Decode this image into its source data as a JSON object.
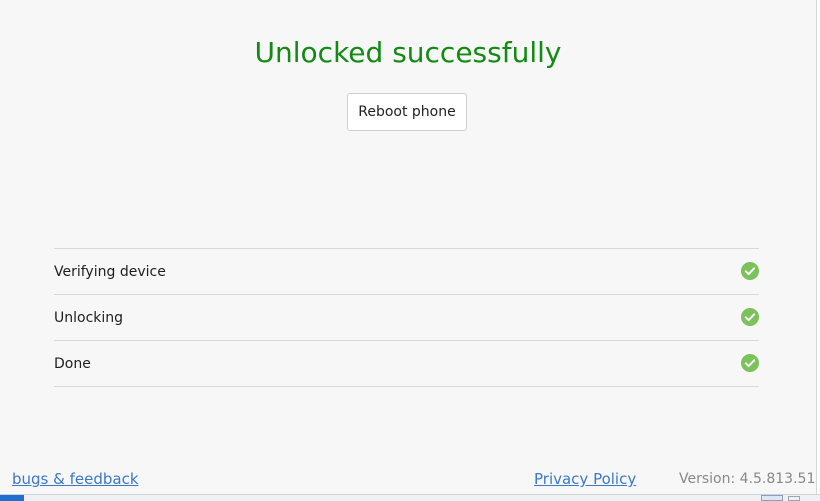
{
  "header": {
    "title": "Unlocked successfully",
    "title_color": "#138a13"
  },
  "actions": {
    "reboot_label": "Reboot phone"
  },
  "steps": [
    {
      "label": "Verifying device",
      "status": "done",
      "icon": "check-circle-icon"
    },
    {
      "label": "Unlocking",
      "status": "done",
      "icon": "check-circle-icon"
    },
    {
      "label": "Done",
      "status": "done",
      "icon": "check-circle-icon"
    }
  ],
  "footer": {
    "bugs_link": "bugs & feedback",
    "privacy_link": "Privacy Policy",
    "version": "Version: 4.5.813.51"
  },
  "colors": {
    "success_green": "#7bc25a",
    "link_blue": "#3b78c9",
    "background": "#f7f7f7"
  }
}
